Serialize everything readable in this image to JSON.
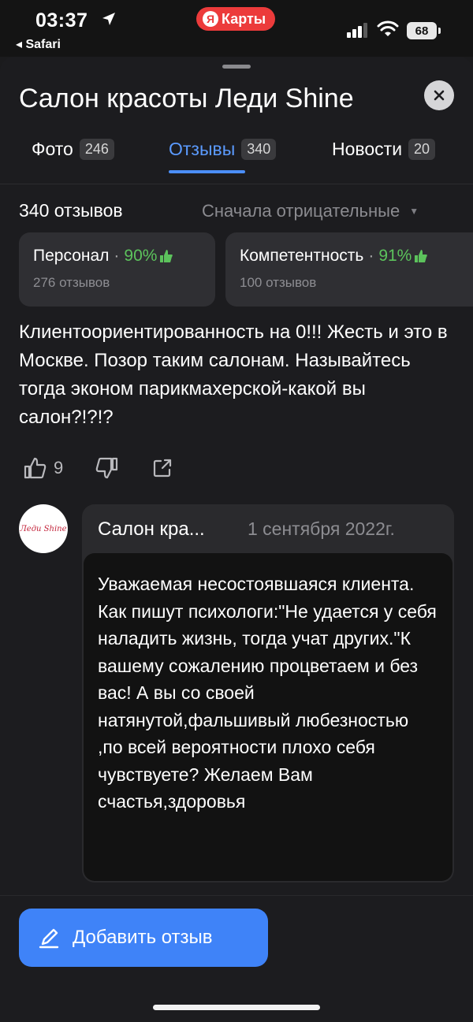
{
  "status_bar": {
    "time": "03:37",
    "back_app": "◂ Safari",
    "app_pill_badge": "Я",
    "app_pill_label": "Карты",
    "battery": "68"
  },
  "place": {
    "title": "Салон красоты Леди Shine"
  },
  "tabs": [
    {
      "label": "Фото",
      "count": "246",
      "active": false
    },
    {
      "label": "Отзывы",
      "count": "340",
      "active": true
    },
    {
      "label": "Новости",
      "count": "20",
      "active": false
    }
  ],
  "reviews": {
    "total_label": "340 отзывов",
    "sort_label": "Сначала отрицательные"
  },
  "aspects": [
    {
      "name": "Персонал",
      "dot": "·",
      "percent": "90%",
      "count": "276 отзывов"
    },
    {
      "name": "Компетентность",
      "dot": "·",
      "percent": "91%",
      "count": "100 отзывов"
    }
  ],
  "review": {
    "text": "Клиентоориентированность на 0!!! Жесть и это в Москве. Позор таким салонам. Называйтесь тогда эконом парикмахерской-какой вы салон?!?!?",
    "likes": "9"
  },
  "reply": {
    "avatar_text": "Леди Shine",
    "author": "Салон кра...",
    "date": "1 сентября 2022г.",
    "text": "Уважаемая несостоявшаяся клиента. Как пишут психологи:\"Не удается у себя наладить жизнь, тогда учат других.\"К вашему сожалению процветаем и без вас! А вы со своей натянутой,фальшивый любезностью ,по всей вероятности плохо себя чувствуете? Желаем Вам счастья,здоровья"
  },
  "add_review_label": "Добавить отзыв",
  "colors": {
    "accent": "#3f83f8",
    "active_tab": "#5b9bff",
    "positive": "#5cc35c",
    "app_pill": "#ec3b3b"
  }
}
